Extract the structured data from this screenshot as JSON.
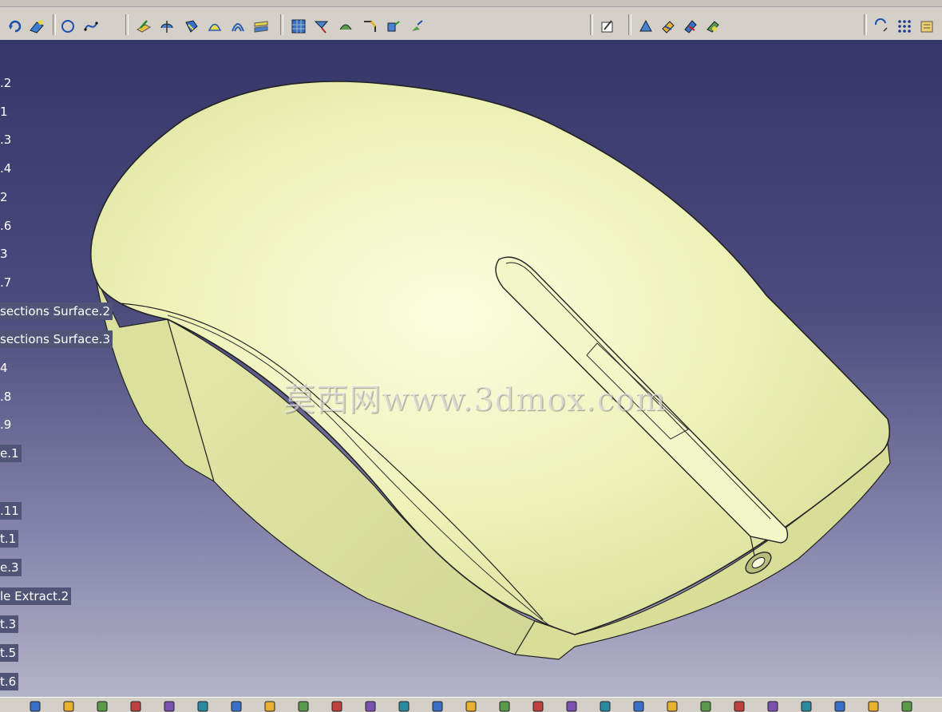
{
  "viewport": {
    "background_top": "#36366a",
    "background_bottom": "#b3b3c8",
    "model_color": "#e8eeac",
    "watermark": "莫西网www.3dmox.com"
  },
  "spec_tree": {
    "items": [
      {
        "label": ".2",
        "highlighted": false
      },
      {
        "label": "1",
        "highlighted": false
      },
      {
        "label": ".3",
        "highlighted": false
      },
      {
        "label": ".4",
        "highlighted": false
      },
      {
        "label": "2",
        "highlighted": false
      },
      {
        "label": ".6",
        "highlighted": false
      },
      {
        "label": "3",
        "highlighted": false
      },
      {
        "label": ".7",
        "highlighted": false
      },
      {
        "label": "sections Surface.2",
        "highlighted": true
      },
      {
        "label": "sections Surface.3",
        "highlighted": true
      },
      {
        "label": "4",
        "highlighted": false
      },
      {
        "label": ".8",
        "highlighted": false
      },
      {
        "label": ".9",
        "highlighted": false
      },
      {
        "label": "e.1",
        "highlighted": true
      },
      {
        "label": "",
        "highlighted": false
      },
      {
        "label": ".11",
        "highlighted": true
      },
      {
        "label": "t.1",
        "highlighted": true
      },
      {
        "label": "e.3",
        "highlighted": true
      },
      {
        "label": "le Extract.2",
        "highlighted": true
      },
      {
        "label": "t.3",
        "highlighted": true
      },
      {
        "label": "t.5",
        "highlighted": true
      },
      {
        "label": "t.6",
        "highlighted": true
      }
    ]
  },
  "top_toolbar": {
    "icons": [
      "rotate-icon",
      "surface-edit-icon",
      "circle-icon",
      "spline-icon",
      "extrude-icon",
      "revolve-icon",
      "sweep-icon",
      "fill-icon",
      "loft-icon",
      "blend-icon",
      "offset-grid-icon",
      "split-icon",
      "fillet-icon",
      "chamfer-icon",
      "translate-icon",
      "pattern-icon",
      "sketch-icon",
      "measure-icon",
      "analysis-icon",
      "draft-icon",
      "curvature-icon",
      "swap-icon",
      "grid-icon",
      "catalog-icon"
    ]
  },
  "bottom_toolbar": {
    "icons": [
      "new-icon",
      "open-icon",
      "save-icon",
      "print-icon",
      "cut-icon",
      "copy-icon",
      "paste-icon",
      "undo-icon",
      "redo-icon",
      "whats-this-icon",
      "formula-icon",
      "knowledge-icon",
      "light-icon",
      "table-icon",
      "grid-snap-icon",
      "lock-icon",
      "filter-icon",
      "fly-icon",
      "render-icon",
      "material-icon",
      "cube-icon",
      "pan-icon",
      "measure-icon",
      "swap-icon",
      "scale-icon",
      "hide-icon",
      "layer-icon"
    ]
  }
}
